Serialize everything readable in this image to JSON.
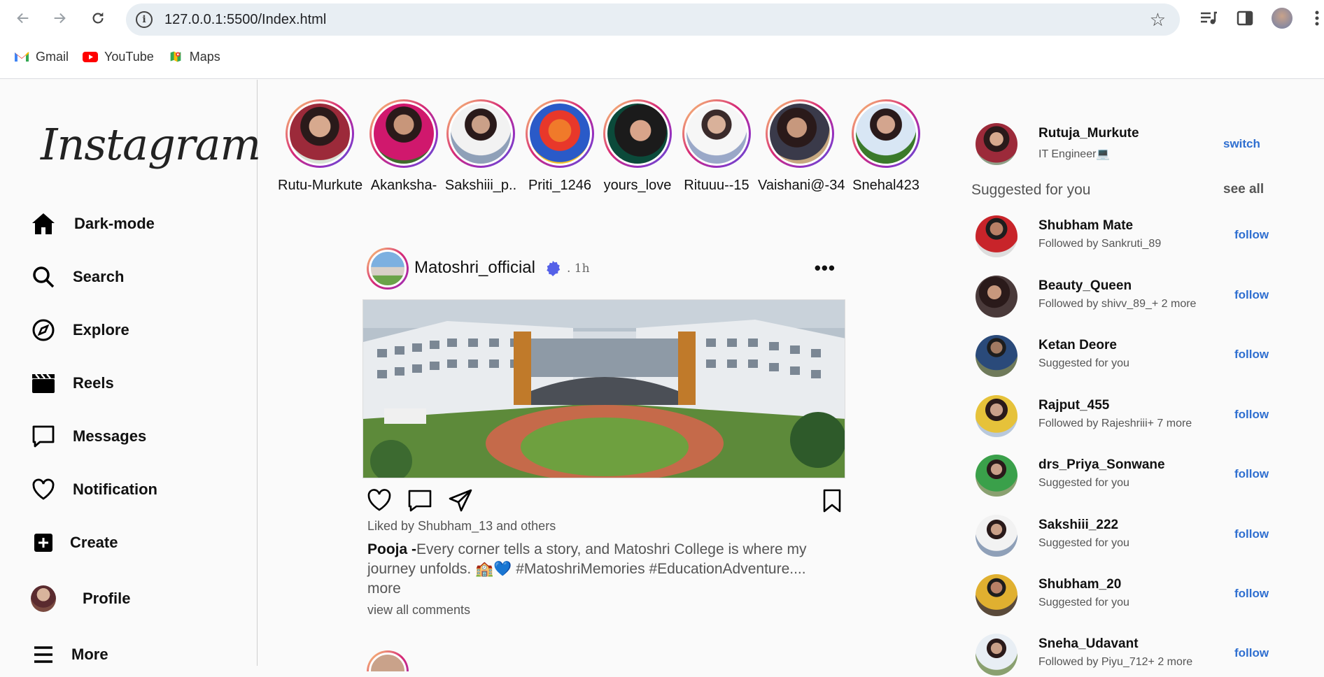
{
  "browser": {
    "url": "127.0.0.1:5500/Index.html",
    "bookmarks": [
      {
        "label": "Gmail",
        "icon": "gmail-icon"
      },
      {
        "label": "YouTube",
        "icon": "youtube-icon"
      },
      {
        "label": "Maps",
        "icon": "maps-icon"
      }
    ]
  },
  "sidebar": {
    "logo": "Instagram",
    "items": [
      {
        "label": "Dark-mode",
        "icon": "home-icon"
      },
      {
        "label": "Search",
        "icon": "search-icon"
      },
      {
        "label": "Explore",
        "icon": "compass-icon"
      },
      {
        "label": "Reels",
        "icon": "clapperboard-icon"
      },
      {
        "label": "Messages",
        "icon": "chat-bubble-icon"
      },
      {
        "label": "Notification",
        "icon": "heart-icon"
      },
      {
        "label": "Create",
        "icon": "plus-square-icon"
      },
      {
        "label": "Profile",
        "icon": "avatar"
      },
      {
        "label": "More",
        "icon": "hamburger-icon"
      }
    ]
  },
  "stories": [
    {
      "name": "Rutu-Murkute"
    },
    {
      "name": "Akanksha-"
    },
    {
      "name": "Sakshiii_p.."
    },
    {
      "name": "Priti_1246"
    },
    {
      "name": "yours_love"
    },
    {
      "name": "Rituuu--15"
    },
    {
      "name": "Vaishani@-34"
    },
    {
      "name": "Snehal423"
    }
  ],
  "post": {
    "username": "Matoshri_official",
    "time": ". 1h",
    "liked_by": "Liked by Shubham_13 and others",
    "caption_author": "Pooja -",
    "caption_text": "Every corner tells a story, and Matoshri College is where my journey unfolds. 🏫💙 #MatoshriMemories #EducationAdventure.... more",
    "view_comments": "view all comments"
  },
  "current_user": {
    "name": "Rutuja_Murkute",
    "subtitle": "IT Engineer💻",
    "switch_label": "switch"
  },
  "suggestions": {
    "title": "Suggested for you",
    "see_all": "see all",
    "follow_label": "follow",
    "items": [
      {
        "name": "Shubham Mate",
        "subtitle": "Followed by Sankruti_89"
      },
      {
        "name": "Beauty_Queen",
        "subtitle": "Followed by shivv_89_+ 2 more"
      },
      {
        "name": "Ketan Deore",
        "subtitle": "Suggested for you"
      },
      {
        "name": "Rajput_455",
        "subtitle": "Followed by Rajeshriii+ 7 more"
      },
      {
        "name": "drs_Priya_Sonwane",
        "subtitle": "Suggested for you"
      },
      {
        "name": "Sakshiii_222",
        "subtitle": "Suggested for you"
      },
      {
        "name": "Shubham_20",
        "subtitle": "Suggested for you"
      },
      {
        "name": "Sneha_Udavant",
        "subtitle": "Followed by Piyu_712+ 2 more"
      }
    ]
  }
}
